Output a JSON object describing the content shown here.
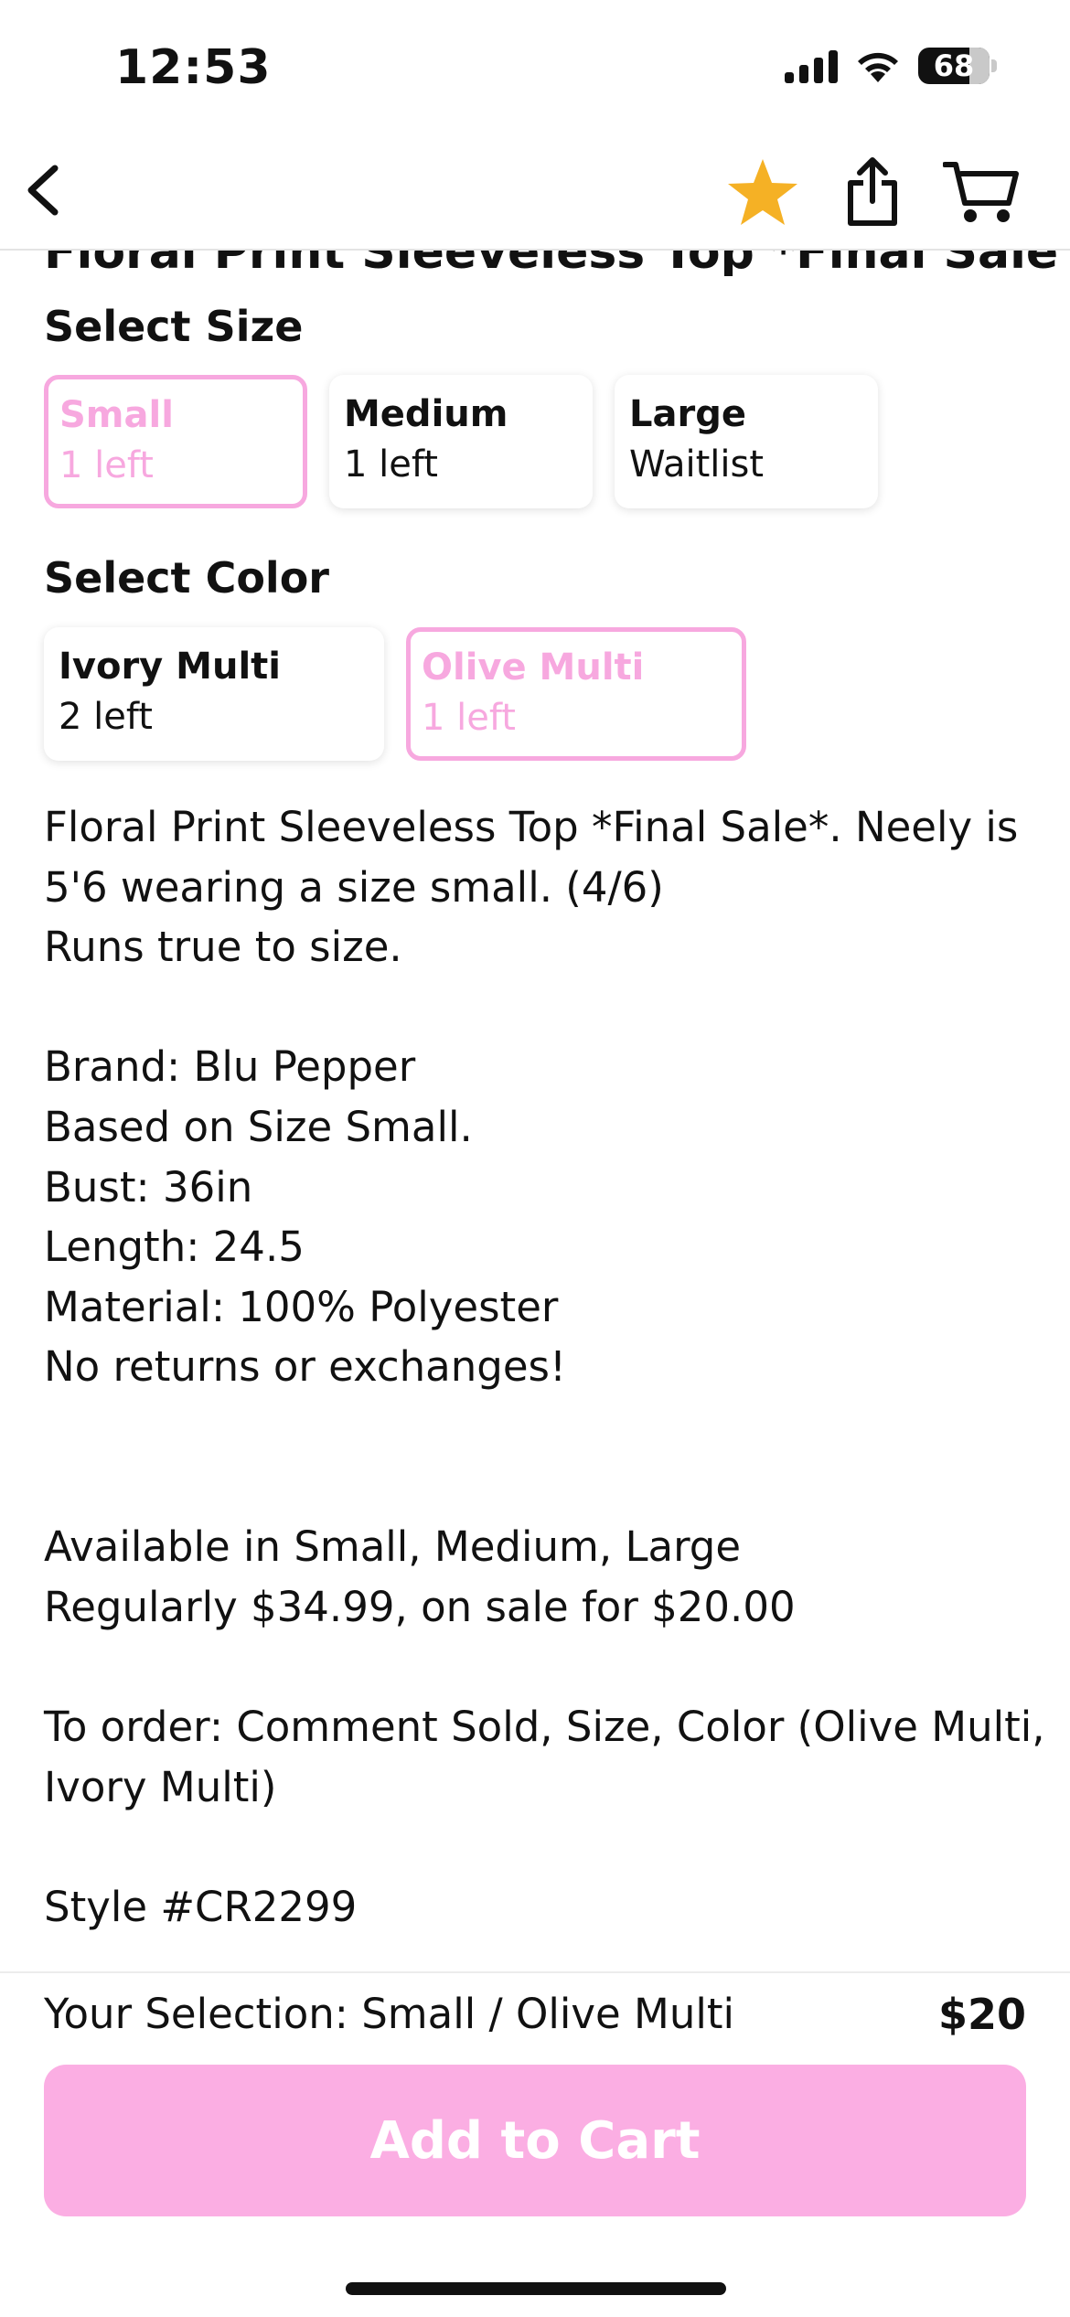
{
  "status_bar": {
    "time": "12:53",
    "battery": "68"
  },
  "nav": {
    "icons": [
      "back-chevron-icon",
      "star-icon",
      "share-icon",
      "cart-icon"
    ],
    "star_color": "#F5B125"
  },
  "product": {
    "title": "Floral Print Sleeveless Top *Final Sale"
  },
  "size": {
    "label": "Select Size",
    "options": [
      {
        "name": "Small",
        "stock": "1 left",
        "selected": true
      },
      {
        "name": "Medium",
        "stock": "1 left",
        "selected": false
      },
      {
        "name": "Large",
        "stock": "Waitlist",
        "selected": false
      }
    ]
  },
  "color": {
    "label": "Select Color",
    "options": [
      {
        "name": "Ivory Multi",
        "stock": "2 left",
        "selected": false
      },
      {
        "name": "Olive Multi",
        "stock": "1 left",
        "selected": true
      }
    ]
  },
  "description": [
    "Floral Print Sleeveless Top *Final Sale*. Neely is",
    "5'6 wearing a size small. (4/6)",
    "Runs true to size.",
    "",
    "Brand: Blu Pepper",
    "Based on Size Small.",
    "Bust: 36in",
    "Length:  24.5",
    "Material: 100% Polyester",
    "No returns or exchanges!",
    "",
    "",
    "Available in Small, Medium, Large",
    "Regularly $34.99, on sale for $20.00",
    "",
    "To order: Comment Sold, Size, Color (Olive Multi,",
    "Ivory Multi)",
    "",
    "Style #CR2299"
  ],
  "footer": {
    "selection": "Your Selection: Small / Olive Multi",
    "price": "$20",
    "button": "Add to Cart",
    "accent": "#F7A8DF"
  }
}
